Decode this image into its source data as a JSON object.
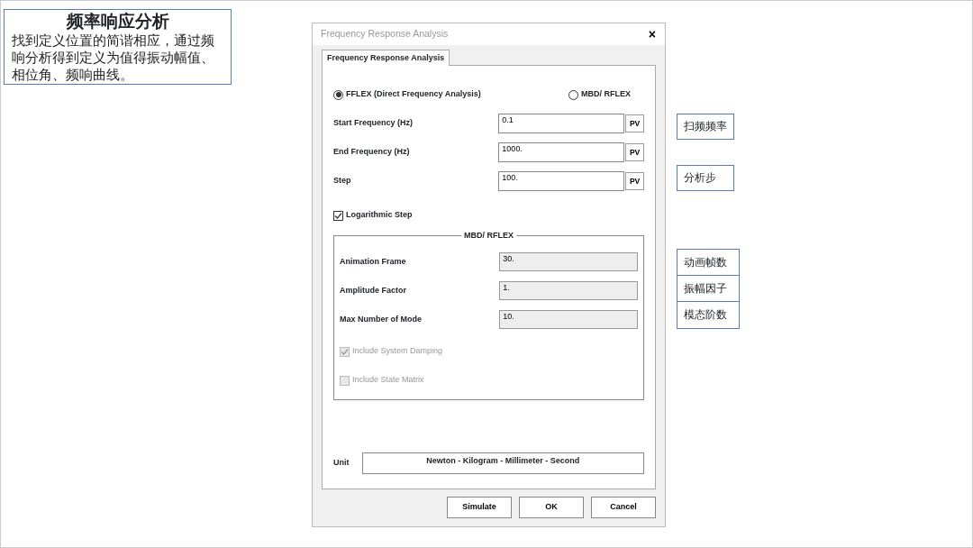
{
  "slide": {
    "title": "频率响应分析",
    "description": "找到定义位置的简谐相应，通过频响分析得到定义为值得振动幅值、相位角、频响曲线。"
  },
  "dialog": {
    "title": "Frequency Response Analysis",
    "close": "×",
    "tabs": [
      {
        "label": "Frequency Response Analysis",
        "selected": true
      }
    ],
    "analysis_types": [
      {
        "label": "FFLEX (Direct Frequency Analysis)",
        "selected": true
      },
      {
        "label": "MBD/ RFLEX",
        "selected": false
      }
    ],
    "fields": [
      {
        "label": "Start Frequency (Hz)",
        "value": "0.1",
        "button": "PV"
      },
      {
        "label": "End Frequency (Hz)",
        "value": "1000.",
        "button": "PV"
      },
      {
        "label": "Step",
        "value": "100.",
        "button": "PV"
      }
    ],
    "logarithmic_step": {
      "label": "Logarithmic Step",
      "checked": true
    },
    "group": {
      "title": "MBD/ RFLEX",
      "fields": [
        {
          "label": "Animation Frame",
          "value": "30.",
          "disabled": true
        },
        {
          "label": "Amplitude Factor",
          "value": "1.",
          "disabled": true
        },
        {
          "label": "Max Number of Mode",
          "value": "10.",
          "disabled": true
        }
      ],
      "options": [
        {
          "label": "Include System Damping",
          "checked": true,
          "disabled": true
        },
        {
          "label": "Include State Matrix",
          "checked": false,
          "disabled": true
        }
      ]
    },
    "unit": {
      "label": "Unit",
      "value": "Newton - Kilogram - Millimeter - Second"
    },
    "buttons": [
      "Simulate",
      "OK",
      "Cancel"
    ]
  },
  "callouts": [
    "扫频频率",
    "分析步"
  ],
  "callout_table": [
    "动画帧数",
    "振幅因子",
    "模态阶数"
  ]
}
